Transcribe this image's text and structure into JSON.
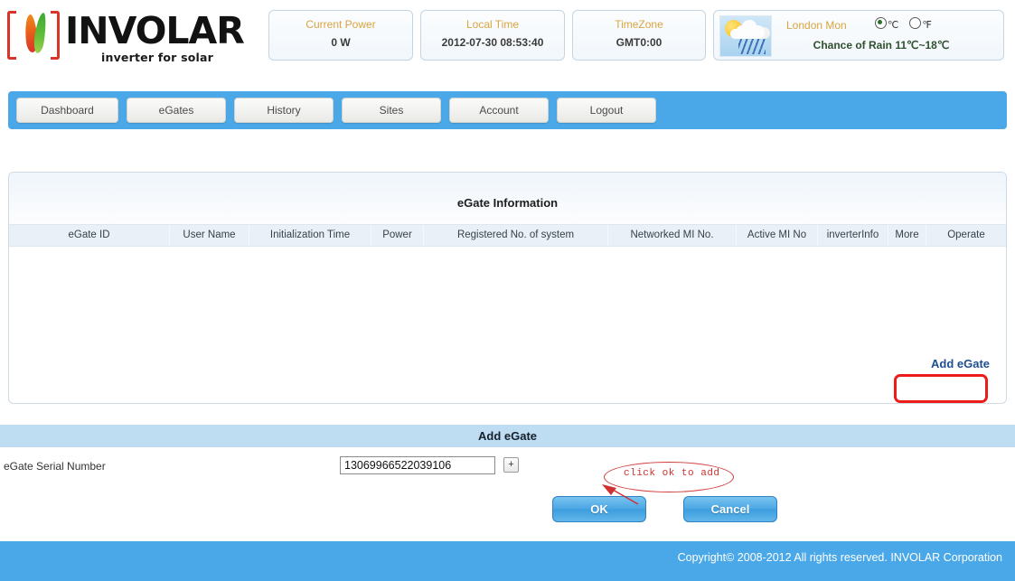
{
  "brand": {
    "name": "INVOLAR",
    "tagline": "inverter for solar",
    "logo_icon": "involar-flame-leaf-logo"
  },
  "header": {
    "boxes": [
      {
        "label": "Current Power",
        "value": "0 W"
      },
      {
        "label": "Local Time",
        "value": "2012-07-30 08:53:40"
      },
      {
        "label": "TimeZone",
        "value": "GMT0:00"
      }
    ],
    "weather": {
      "icon": "sun-cloud-rain-icon",
      "location_day": "London Mon",
      "unit_celsius": "℃",
      "unit_fahrenheit": "℉",
      "selected_unit": "celsius",
      "forecast": "Chance of Rain 11℃~18℃"
    }
  },
  "nav": {
    "items": [
      {
        "label": "Dashboard"
      },
      {
        "label": "eGates"
      },
      {
        "label": "History"
      },
      {
        "label": "Sites"
      },
      {
        "label": "Account"
      },
      {
        "label": "Logout"
      }
    ]
  },
  "panel": {
    "title": "eGate Information",
    "columns": [
      "eGate ID",
      "User Name",
      "Initialization Time",
      "Power",
      "Registered No. of system",
      "Networked MI No.",
      "Active MI No",
      "inverterInfo",
      "More",
      "Operate"
    ],
    "rows": [],
    "add_link": "Add eGate"
  },
  "form": {
    "title": "Add eGate",
    "serial_label": "eGate Serial Number",
    "serial_value": "13069966522039106",
    "serial_placeholder": "",
    "plus_label": "+",
    "ok_label": "OK",
    "cancel_label": "Cancel"
  },
  "annotations": {
    "highlight_target": "Add eGate",
    "callout_text": "click ok to add"
  },
  "footer": {
    "copyright": "Copyright© 2008-2012 All rights reserved. INVOLAR Corporation"
  },
  "colors": {
    "nav_blue": "#4aa8e8",
    "label_orange": "#d9a441",
    "annotation_red": "#ee1b1b",
    "link_blue": "#1e4f8f",
    "form_bar_blue": "#bedcf2"
  }
}
